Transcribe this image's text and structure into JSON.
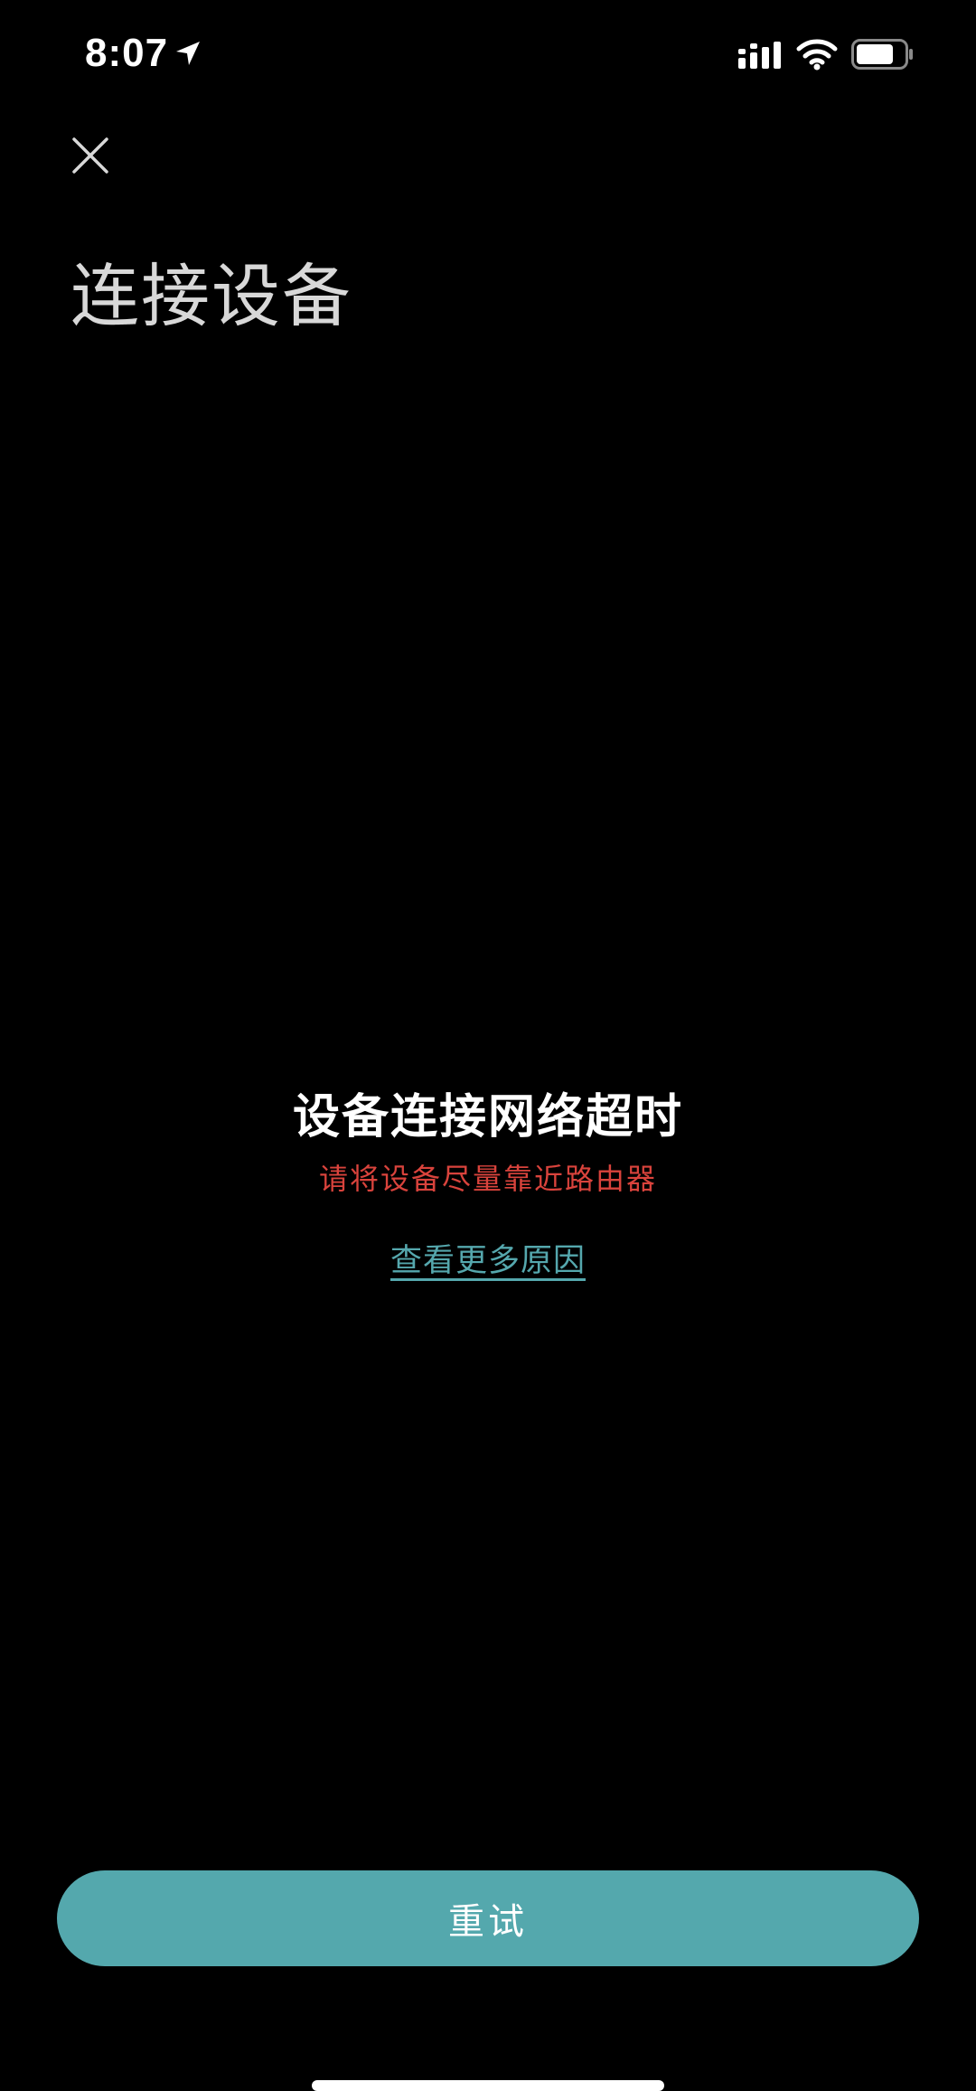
{
  "status_bar": {
    "time": "8:07",
    "icons": [
      "location-arrow-icon",
      "signal-icon",
      "wifi-icon",
      "battery-icon"
    ]
  },
  "header": {
    "close_icon": "close-icon",
    "title": "连接设备"
  },
  "message": {
    "title": "设备连接网络超时",
    "hint": "请将设备尽量靠近路由器",
    "link": "查看更多原因"
  },
  "actions": {
    "retry_label": "重试"
  },
  "colors": {
    "background": "#000000",
    "accent": "#54a8ad",
    "link": "#55a7ad",
    "error": "#d9433c",
    "title_text": "#d8d8d8"
  }
}
